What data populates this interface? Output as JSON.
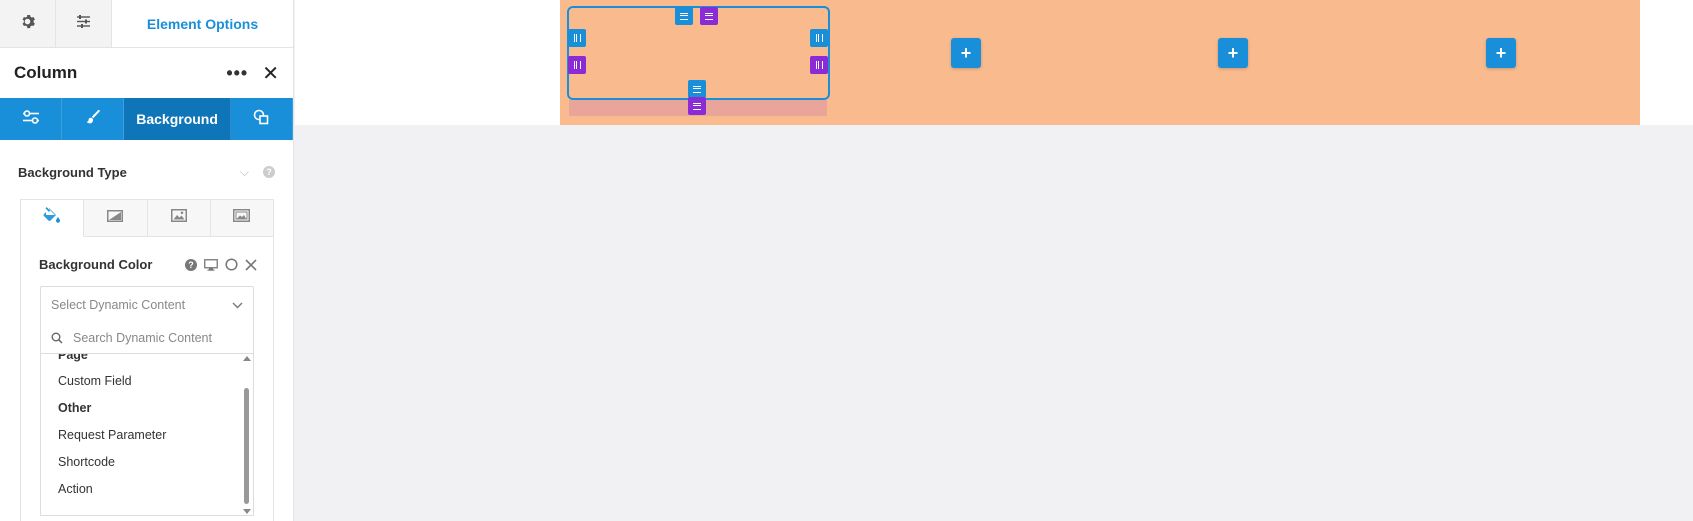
{
  "top_tabs": {
    "settings_icon": "gear-icon",
    "adjust_icon": "sliders-icon",
    "title": "Element Options"
  },
  "header": {
    "title": "Column",
    "more_icon": "more-dots-icon",
    "close_icon": "close-icon"
  },
  "blue_tabs": [
    {
      "icon": "toggle-icon"
    },
    {
      "icon": "brush-icon"
    },
    {
      "label": "Background"
    },
    {
      "icon": "shapes-icon"
    }
  ],
  "background_type": {
    "label": "Background Type"
  },
  "type_tabs": [
    "paint-bucket-icon",
    "gradient-icon",
    "image-icon",
    "slideshow-icon"
  ],
  "background_color": {
    "label": "Background Color",
    "select_placeholder": "Select Dynamic Content",
    "search_placeholder": "Search Dynamic Content",
    "list": [
      {
        "label": "Page",
        "group": true
      },
      {
        "label": "Custom Field",
        "group": false
      },
      {
        "label": "Other",
        "group": true
      },
      {
        "label": "Request Parameter",
        "group": false
      },
      {
        "label": "Shortcode",
        "group": false
      },
      {
        "label": "Action",
        "group": false
      }
    ]
  },
  "colors": {
    "accent": "#198fd9",
    "accent_dark": "#0f75b9",
    "purple": "#8a2bd6",
    "row_bg": "#f9bb8e",
    "canvas_bg": "#f1f1f3"
  }
}
